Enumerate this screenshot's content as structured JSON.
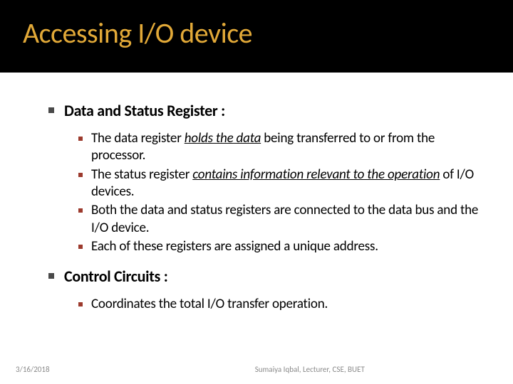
{
  "header": {
    "title": "Accessing I/O device"
  },
  "sections": [
    {
      "heading": "Data and Status Register :",
      "items": [
        {
          "pre": " The data register ",
          "styled": "holds the data",
          "styleClass": "u i",
          "post": " being transferred to or from the processor."
        },
        {
          "pre": "The status register ",
          "styled": "contains information relevant to the operation",
          "styleClass": "u i",
          "post": " of I/O devices."
        },
        {
          "pre": "Both the data and status registers are connected to the data bus and the I/O device.",
          "styled": "",
          "styleClass": "",
          "post": ""
        },
        {
          "pre": "Each of these registers are assigned a unique address.",
          "styled": "",
          "styleClass": "",
          "post": ""
        }
      ]
    },
    {
      "heading": "Control Circuits :",
      "items": [
        {
          "pre": "Coordinates the total I/O transfer operation.",
          "styled": "",
          "styleClass": "",
          "post": ""
        }
      ]
    }
  ],
  "footer": {
    "date": "3/16/2018",
    "credit": "Sumaiya Iqbal, Lecturer, CSE, BUET"
  }
}
